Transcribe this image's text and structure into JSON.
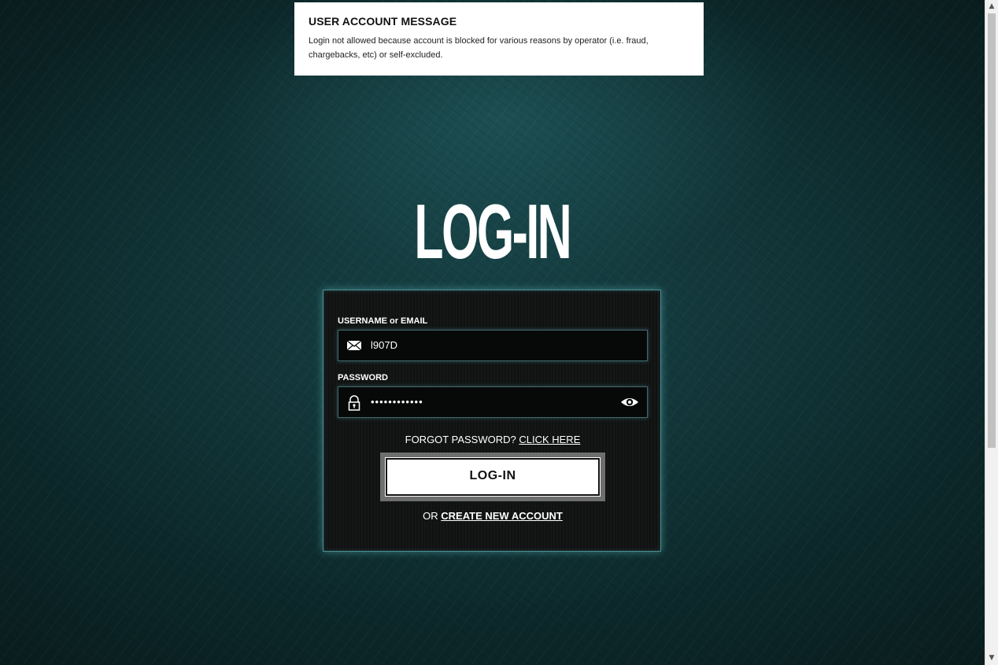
{
  "message": {
    "title": "USER ACCOUNT MESSAGE",
    "body": "Login not allowed because account is blocked for various reasons by operator (i.e. fraud, chargebacks, etc) or self-excluded."
  },
  "page": {
    "title": "LOG-IN"
  },
  "form": {
    "username_label": "USERNAME or EMAIL",
    "username_value": "l907D",
    "password_label": "PASSWORD",
    "password_value": "••••••••••••",
    "forgot_text": "FORGOT PASSWORD?",
    "forgot_link": "CLICK HERE",
    "login_button": "LOG-IN",
    "or_text": "OR",
    "create_link": "CREATE NEW ACCOUNT"
  },
  "icons": {
    "username": "envelope-icon",
    "password": "lock-icon",
    "toggle": "eye-icon"
  },
  "colors": {
    "panel_border": "#4b8f91",
    "background": "#0c2729",
    "button_bg": "#ffffff"
  }
}
